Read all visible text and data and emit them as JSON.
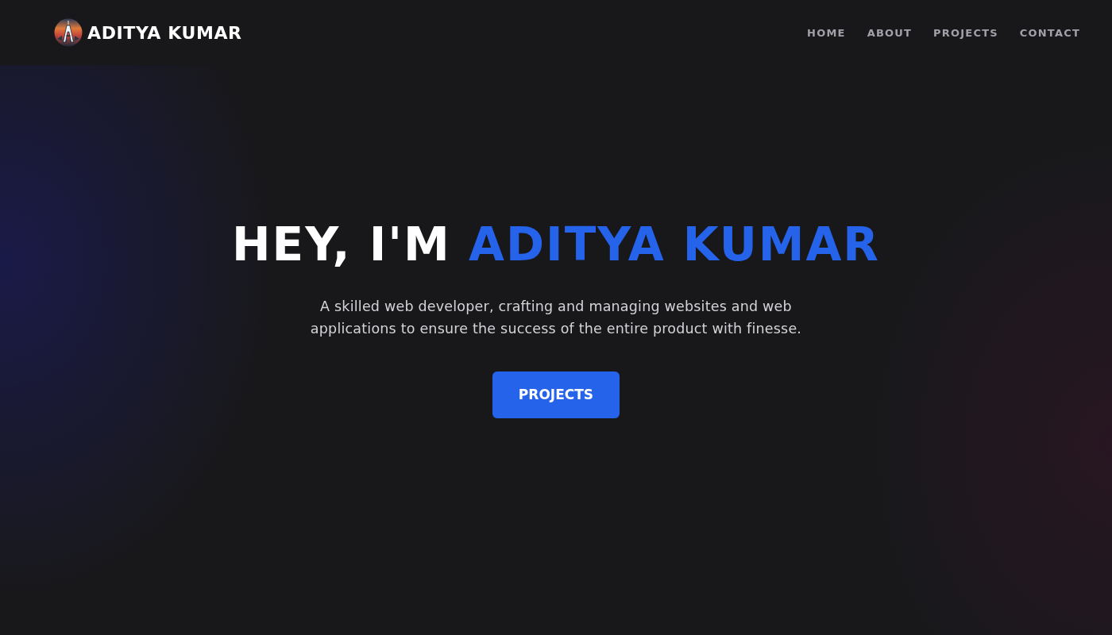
{
  "header": {
    "brand": "ADITYA KUMAR",
    "nav": [
      {
        "label": "HOME"
      },
      {
        "label": "ABOUT"
      },
      {
        "label": "PROJECTS"
      },
      {
        "label": "CONTACT"
      }
    ]
  },
  "hero": {
    "heading_lead": "HEY, I'M",
    "heading_highlight": "ADITYA KUMAR",
    "subtitle": "A skilled web developer, crafting and managing websites and web applications to ensure the success of the entire product with finesse.",
    "button": "PROJECTS"
  }
}
